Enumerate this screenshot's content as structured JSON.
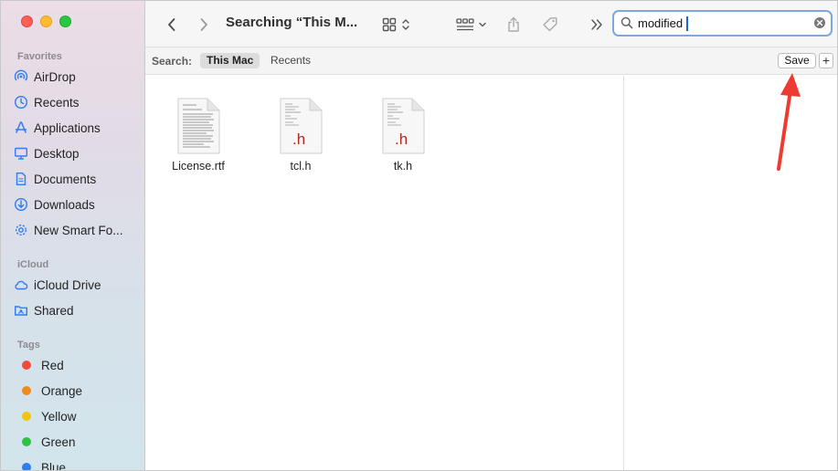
{
  "window": {
    "title": "Searching “This M..."
  },
  "sidebar": {
    "favorites_title": "Favorites",
    "favorites": [
      {
        "label": "AirDrop",
        "icon": "airdrop-icon"
      },
      {
        "label": "Recents",
        "icon": "clock-icon"
      },
      {
        "label": "Applications",
        "icon": "applications-icon"
      },
      {
        "label": "Desktop",
        "icon": "desktop-icon"
      },
      {
        "label": "Documents",
        "icon": "document-icon"
      },
      {
        "label": "Downloads",
        "icon": "download-icon"
      },
      {
        "label": "New Smart Fo...",
        "icon": "gear-icon"
      }
    ],
    "icloud_title": "iCloud",
    "icloud": [
      {
        "label": "iCloud Drive",
        "icon": "cloud-icon"
      },
      {
        "label": "Shared",
        "icon": "shared-folder-icon"
      }
    ],
    "tags_title": "Tags",
    "tags": [
      {
        "label": "Red",
        "color": "#f04a3f"
      },
      {
        "label": "Orange",
        "color": "#f08a1f"
      },
      {
        "label": "Yellow",
        "color": "#f1c40f"
      },
      {
        "label": "Green",
        "color": "#2fc243"
      },
      {
        "label": "Blue",
        "color": "#2f7df0"
      }
    ]
  },
  "search": {
    "value": "modified",
    "scope_label": "Search:",
    "scopes": [
      "This Mac",
      "Recents"
    ],
    "active_scope": "This Mac",
    "save_label": "Save",
    "plus_label": "+"
  },
  "files": [
    {
      "name": "License.rtf",
      "type": "rtf"
    },
    {
      "name": "tcl.h",
      "type": "h",
      "badge": ".h"
    },
    {
      "name": "tk.h",
      "type": "h",
      "badge": ".h"
    }
  ],
  "colors": {
    "accent": "#1d63d8",
    "search_focus": "#7ea7df",
    "annotation_arrow": "#ee3a32"
  }
}
